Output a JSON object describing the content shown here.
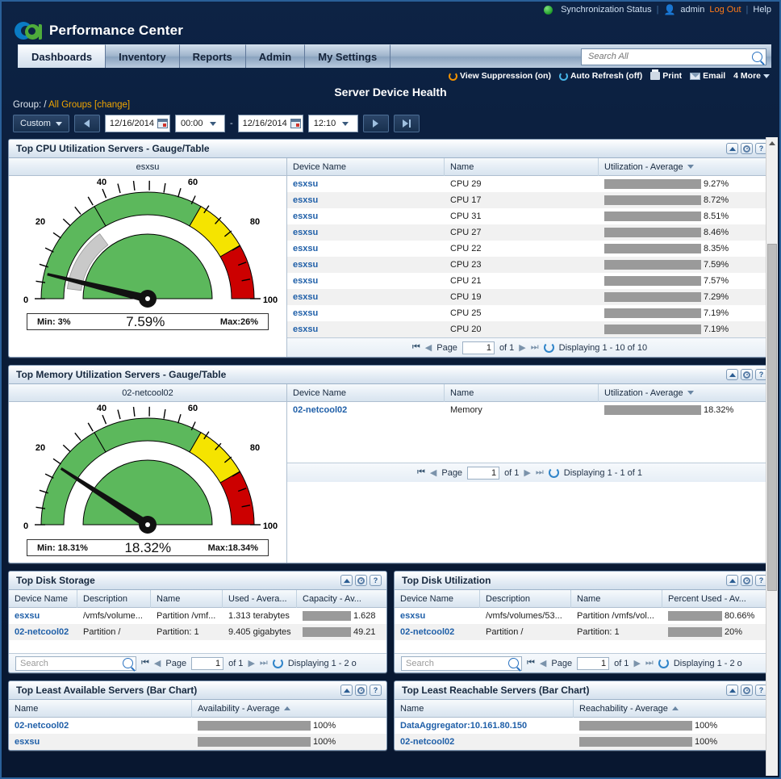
{
  "header": {
    "sync_status": "Synchronization Status",
    "user": "admin",
    "logout": "Log Out",
    "help": "Help",
    "brand": "Performance Center",
    "logo_icon": "ca-logo-icon"
  },
  "tabs": [
    {
      "label": "Dashboards",
      "active": true
    },
    {
      "label": "Inventory",
      "active": false
    },
    {
      "label": "Reports",
      "active": false
    },
    {
      "label": "Admin",
      "active": false
    },
    {
      "label": "My Settings",
      "active": false
    }
  ],
  "search": {
    "placeholder": "Search All",
    "value": ""
  },
  "actions": [
    {
      "label": "View Suppression (on)",
      "icon": "refresh-orange-icon"
    },
    {
      "label": "Auto Refresh (off)",
      "icon": "refresh-blue-icon"
    },
    {
      "label": "Print",
      "icon": "printer-icon"
    },
    {
      "label": "Email",
      "icon": "mail-icon"
    },
    {
      "label": "4 More",
      "icon": "chevron-down-icon"
    }
  ],
  "page": {
    "title": "Server Device Health",
    "group_label": "Group: /",
    "group_value": "All Groups [change]"
  },
  "timebar": {
    "range_preset": "Custom",
    "start_date": "12/16/2014",
    "start_time": "00:00",
    "separator": "-",
    "end_date": "12/16/2014",
    "end_time": "12:10"
  },
  "panels": {
    "cpu": {
      "title": "Top CPU Utilization Servers - Gauge/Table",
      "gauge_label": "esxsu",
      "gauge": {
        "min_label": "Min:  3%",
        "value_label": "7.59%",
        "max_label": "Max:26%",
        "value": 7.59,
        "min": 3,
        "max": 26,
        "ticks": [
          "0",
          "20",
          "40",
          "60",
          "80",
          "100"
        ],
        "green_end": 60,
        "yellow_end": 80,
        "red_end": 100
      },
      "columns": [
        "Device Name",
        "Name",
        "Utilization - Average"
      ],
      "sort_col": 2,
      "sort_dir": "desc",
      "rows": [
        {
          "device": "esxsu",
          "name": "CPU 29",
          "value": 9.27,
          "value_label": "9.27%"
        },
        {
          "device": "esxsu",
          "name": "CPU 17",
          "value": 8.72,
          "value_label": "8.72%"
        },
        {
          "device": "esxsu",
          "name": "CPU 31",
          "value": 8.51,
          "value_label": "8.51%"
        },
        {
          "device": "esxsu",
          "name": "CPU 27",
          "value": 8.46,
          "value_label": "8.46%"
        },
        {
          "device": "esxsu",
          "name": "CPU 22",
          "value": 8.35,
          "value_label": "8.35%"
        },
        {
          "device": "esxsu",
          "name": "CPU 23",
          "value": 7.59,
          "value_label": "7.59%"
        },
        {
          "device": "esxsu",
          "name": "CPU 21",
          "value": 7.57,
          "value_label": "7.57%"
        },
        {
          "device": "esxsu",
          "name": "CPU 19",
          "value": 7.29,
          "value_label": "7.29%"
        },
        {
          "device": "esxsu",
          "name": "CPU 25",
          "value": 7.19,
          "value_label": "7.19%"
        },
        {
          "device": "esxsu",
          "name": "CPU 20",
          "value": 7.19,
          "value_label": "7.19%"
        }
      ],
      "pager": {
        "page_label": "Page",
        "page": "1",
        "of": "of 1",
        "displaying": "Displaying 1 - 10 of 10"
      }
    },
    "memory": {
      "title": "Top Memory Utilization Servers - Gauge/Table",
      "gauge_label": "02-netcool02",
      "gauge": {
        "min_label": "Min: 18.31%",
        "value_label": "18.32%",
        "max_label": "Max:18.34%",
        "value": 18.32,
        "min": 18.31,
        "max": 18.34,
        "ticks": [
          "0",
          "20",
          "40",
          "60",
          "80",
          "100"
        ],
        "green_end": 60,
        "yellow_end": 80,
        "red_end": 100
      },
      "columns": [
        "Device Name",
        "Name",
        "Utilization - Average"
      ],
      "sort_col": 2,
      "sort_dir": "desc",
      "rows": [
        {
          "device": "02-netcool02",
          "name": "Memory",
          "value": 18.32,
          "value_label": "18.32%"
        }
      ],
      "pager": {
        "page_label": "Page",
        "page": "1",
        "of": "of 1",
        "displaying": "Displaying 1 - 1 of 1"
      }
    },
    "disk_storage": {
      "title": "Top Disk Storage",
      "columns": [
        "Device Name",
        "Description",
        "Name",
        "Used - Avera...",
        "Capacity - Av..."
      ],
      "sort_col": 3,
      "rows": [
        {
          "device": "esxsu",
          "description": "/vmfs/volume...",
          "name": "Partition /vmf...",
          "used": "1.313 terabytes",
          "capacity": "1.628",
          "capacity_pct": 62
        },
        {
          "device": "02-netcool02",
          "description": "Partition /",
          "name": "Partition: 1",
          "used": "9.405 gigabytes",
          "capacity": "49.21",
          "capacity_pct": 62
        }
      ],
      "pager": {
        "search_placeholder": "Search",
        "page_label": "Page",
        "page": "1",
        "of": "of 1",
        "displaying": "Displaying 1 - 2 o"
      }
    },
    "disk_utilization": {
      "title": "Top Disk Utilization",
      "columns": [
        "Device Name",
        "Description",
        "Name",
        "Percent Used - Av..."
      ],
      "rows": [
        {
          "device": "esxsu",
          "description": "/vmfs/volumes/53...",
          "name": "Partition /vmfs/vol...",
          "value": 80.66,
          "value_label": "80.66%"
        },
        {
          "device": "02-netcool02",
          "description": "Partition /",
          "name": "Partition: 1",
          "value": 20,
          "value_label": "20%"
        }
      ],
      "pager": {
        "search_placeholder": "Search",
        "page_label": "Page",
        "page": "1",
        "of": "of 1",
        "displaying": "Displaying 1 - 2 o"
      }
    },
    "least_available": {
      "title": "Top Least Available Servers (Bar Chart)",
      "columns": [
        "Name",
        "Availability - Average"
      ],
      "sort_col": 1,
      "sort_dir": "asc",
      "rows": [
        {
          "name": "02-netcool02",
          "value": 100,
          "value_label": "100%"
        },
        {
          "name": "esxsu",
          "value": 100,
          "value_label": "100%"
        }
      ]
    },
    "least_reachable": {
      "title": "Top Least Reachable Servers (Bar Chart)",
      "columns": [
        "Name",
        "Reachability - Average"
      ],
      "sort_col": 1,
      "sort_dir": "asc",
      "rows": [
        {
          "name": "DataAggregator:10.161.80.150",
          "value": 100,
          "value_label": "100%"
        },
        {
          "name": "02-netcool02",
          "value": 100,
          "value_label": "100%"
        }
      ]
    }
  },
  "panel_buttons": {
    "collapse": "collapse-icon",
    "settings": "gear-icon",
    "help": "?"
  },
  "chart_data": [
    {
      "type": "bar",
      "title": "Top CPU Utilization Servers",
      "categories": [
        "CPU 29",
        "CPU 17",
        "CPU 31",
        "CPU 27",
        "CPU 22",
        "CPU 23",
        "CPU 21",
        "CPU 19",
        "CPU 25",
        "CPU 20"
      ],
      "values": [
        9.27,
        8.72,
        8.51,
        8.46,
        8.35,
        7.59,
        7.57,
        7.29,
        7.19,
        7.19
      ],
      "ylabel": "Utilization - Average (%)",
      "ylim": [
        0,
        100
      ],
      "series_color": "#5cb85c"
    },
    {
      "type": "bar",
      "title": "Top Memory Utilization Servers",
      "categories": [
        "Memory"
      ],
      "values": [
        18.32
      ],
      "ylabel": "Utilization - Average (%)",
      "ylim": [
        0,
        100
      ],
      "series_color": "#5cb85c"
    },
    {
      "type": "bar",
      "title": "Top Disk Utilization",
      "categories": [
        "Partition /vmfs/vol...",
        "Partition: 1"
      ],
      "values": [
        80.66,
        20
      ],
      "ylabel": "Percent Used - Average (%)",
      "ylim": [
        0,
        100
      ],
      "series_color": "#12499b"
    },
    {
      "type": "bar",
      "title": "Top Least Available Servers (Bar Chart)",
      "categories": [
        "02-netcool02",
        "esxsu"
      ],
      "values": [
        100,
        100
      ],
      "ylabel": "Availability - Average (%)",
      "ylim": [
        0,
        100
      ],
      "series_color": "#12499b"
    },
    {
      "type": "bar",
      "title": "Top Least Reachable Servers (Bar Chart)",
      "categories": [
        "DataAggregator:10.161.80.150",
        "02-netcool02"
      ],
      "values": [
        100,
        100
      ],
      "ylabel": "Reachability - Average (%)",
      "ylim": [
        0,
        100
      ],
      "series_color": "#6cc04a"
    }
  ]
}
